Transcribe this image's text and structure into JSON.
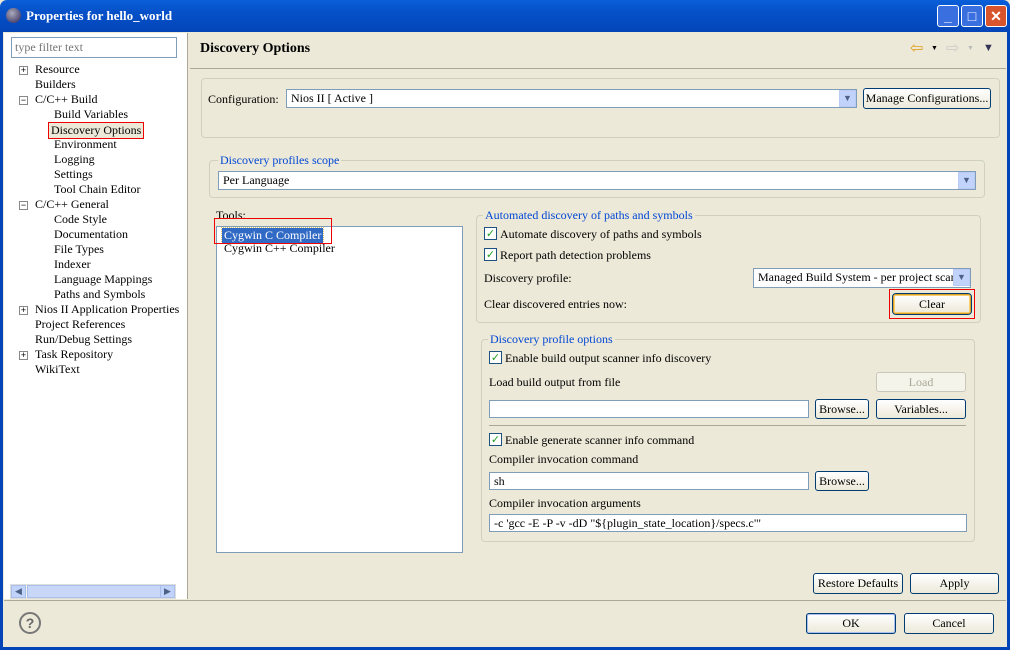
{
  "window": {
    "title": "Properties for hello_world",
    "minimize": "_",
    "maximize": "□",
    "close": "✕"
  },
  "sidebar": {
    "filter_placeholder": "type filter text",
    "items": [
      {
        "label": "Resource",
        "level": 1,
        "expander": "+"
      },
      {
        "label": "Builders",
        "level": 1
      },
      {
        "label": "C/C++ Build",
        "level": 1,
        "expander": "−"
      },
      {
        "label": "Build Variables",
        "level": 2
      },
      {
        "label": "Discovery Options",
        "level": 2,
        "selected": true
      },
      {
        "label": "Environment",
        "level": 2
      },
      {
        "label": "Logging",
        "level": 2
      },
      {
        "label": "Settings",
        "level": 2
      },
      {
        "label": "Tool Chain Editor",
        "level": 2
      },
      {
        "label": "C/C++ General",
        "level": 1,
        "expander": "−"
      },
      {
        "label": "Code Style",
        "level": 2
      },
      {
        "label": "Documentation",
        "level": 2
      },
      {
        "label": "File Types",
        "level": 2
      },
      {
        "label": "Indexer",
        "level": 2
      },
      {
        "label": "Language Mappings",
        "level": 2
      },
      {
        "label": "Paths and Symbols",
        "level": 2
      },
      {
        "label": "Nios II Application Properties",
        "level": 1,
        "expander": "+"
      },
      {
        "label": "Project References",
        "level": 1
      },
      {
        "label": "Run/Debug Settings",
        "level": 1
      },
      {
        "label": "Task Repository",
        "level": 1,
        "expander": "+"
      },
      {
        "label": "WikiText",
        "level": 1
      }
    ]
  },
  "header": {
    "title": "Discovery Options",
    "back": "⇦",
    "forward": "⇨",
    "menu": "▼"
  },
  "config": {
    "label": "Configuration:",
    "value": "Nios II  [ Active ]",
    "manage": "Manage Configurations..."
  },
  "scope": {
    "title": "Discovery profiles scope",
    "value": "Per Language"
  },
  "tools": {
    "label": "Tools:",
    "items": [
      "Cygwin C Compiler",
      "Cygwin C++ Compiler"
    ]
  },
  "automated": {
    "title": "Automated discovery of paths and symbols",
    "automate": "Automate discovery of paths and symbols",
    "automate_checked": true,
    "report": "Report path detection problems",
    "report_checked": true,
    "profile_label": "Discovery profile:",
    "profile_value": "Managed Build System - per project scanr",
    "clear_label": "Clear discovered entries now:",
    "clear_btn": "Clear"
  },
  "profile_options": {
    "title": "Discovery profile options",
    "enable_build": "Enable build output scanner info discovery",
    "enable_build_checked": true,
    "load_label": "Load build output from file",
    "load_btn": "Load",
    "load_value": "",
    "browse": "Browse...",
    "variables": "Variables...",
    "enable_gen": "Enable generate scanner info command",
    "enable_gen_checked": true,
    "cmd_label": "Compiler invocation command",
    "cmd_value": "sh",
    "browse2": "Browse...",
    "args_label": "Compiler invocation arguments",
    "args_value": "-c 'gcc -E -P -v -dD \"${plugin_state_location}/specs.c\"'"
  },
  "footer": {
    "restore": "Restore Defaults",
    "apply": "Apply",
    "ok": "OK",
    "cancel": "Cancel",
    "help": "?"
  }
}
